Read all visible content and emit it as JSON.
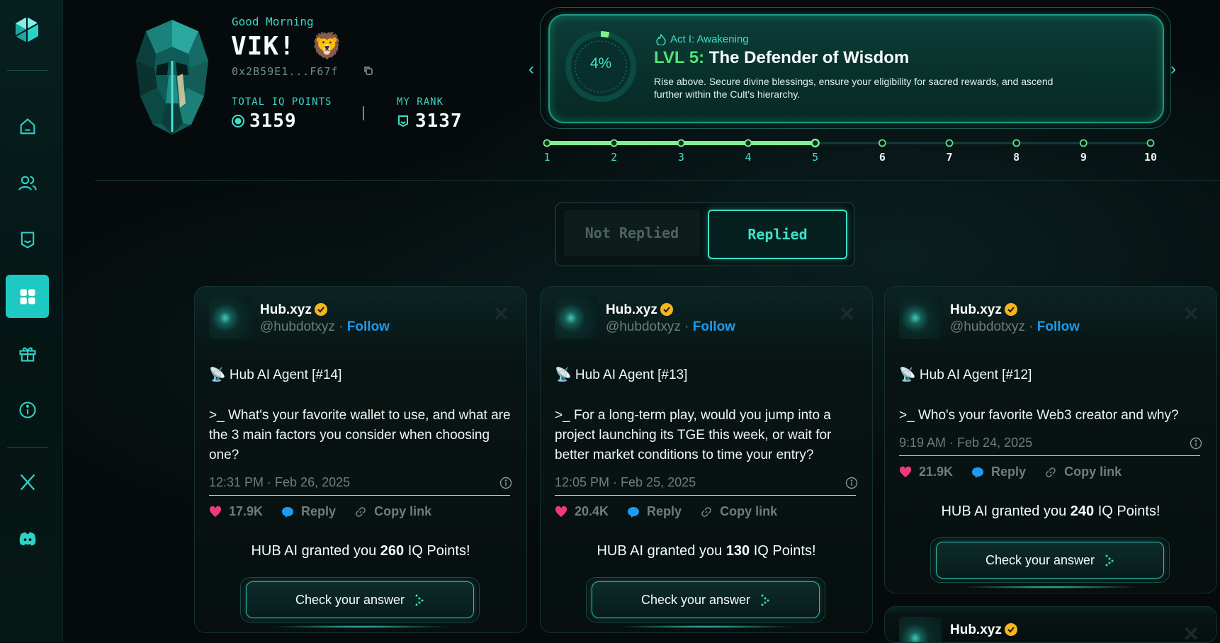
{
  "profile": {
    "greeting": "Good Morning",
    "username": "VIK!",
    "emoji": "🦁",
    "wallet": "0x2B59E1...F67f",
    "total_iq_label": "TOTAL IQ POINTS",
    "total_iq_value": "3159",
    "rank_label": "MY RANK",
    "rank_value": "3137"
  },
  "level": {
    "percent_label": "4%",
    "percent": 4,
    "act": "Act I: Awakening",
    "lvl_prefix": "LVL 5:",
    "title": "The Defender of Wisdom",
    "description": "Rise above. Secure divine blessings, ensure your eligibility for sacred rewards, and ascend further within the Cult's hierarchy.",
    "prev_icon": "chevron-left-icon",
    "next_icon": "chevron-right-icon"
  },
  "progress": {
    "steps": [
      "1",
      "2",
      "3",
      "4",
      "5",
      "6",
      "7",
      "8",
      "9",
      "10"
    ],
    "current": 5,
    "accent": "#7ef08f"
  },
  "tabs": {
    "not_replied": "Not Replied",
    "replied": "Replied",
    "active": "replied"
  },
  "cards": [
    {
      "name": "Hub.xyz",
      "handle": "@hubdotxyz",
      "follow": "Follow",
      "agent": "📡 Hub AI Agent [#14]",
      "question": ">_ What's your favorite wallet to use, and what are the 3 main factors you consider when choosing one?",
      "time": "12:31 PM · Feb 26, 2025",
      "likes": "17.9K",
      "reply": "Reply",
      "copy": "Copy link",
      "granted_prefix": "HUB AI granted you",
      "points": "260",
      "granted_suffix": "IQ Points!",
      "button": "Check your answer"
    },
    {
      "name": "Hub.xyz",
      "handle": "@hubdotxyz",
      "follow": "Follow",
      "agent": "📡 Hub AI Agent [#13]",
      "question": ">_ For a long-term play, would you jump into a project launching its TGE this week, or wait for better market conditions to time your entry?",
      "time": "12:05 PM · Feb 25, 2025",
      "likes": "20.4K",
      "reply": "Reply",
      "copy": "Copy link",
      "granted_prefix": "HUB AI granted you",
      "points": "130",
      "granted_suffix": "IQ Points!",
      "button": "Check your answer"
    },
    {
      "name": "Hub.xyz",
      "handle": "@hubdotxyz",
      "follow": "Follow",
      "agent": "📡 Hub AI Agent [#12]",
      "question": ">_ Who's your favorite Web3 creator and why?",
      "time": "9:19 AM · Feb 24, 2025",
      "likes": "21.9K",
      "reply": "Reply",
      "copy": "Copy link",
      "granted_prefix": "HUB AI granted you",
      "points": "240",
      "granted_suffix": "IQ Points!",
      "button": "Check your answer"
    },
    {
      "name": "Hub.xyz"
    }
  ],
  "colors": {
    "accent": "#3fe0c8",
    "sidebar_active": "#1ec9c4",
    "heart": "#f0397a",
    "reply": "#1d9bf0",
    "lvl": "#4fe37c"
  },
  "sidebar": [
    "logo-icon",
    "home-icon",
    "users-icon",
    "badge-icon",
    "apps-icon",
    "gift-icon",
    "info-icon",
    "x-icon",
    "discord-icon"
  ]
}
